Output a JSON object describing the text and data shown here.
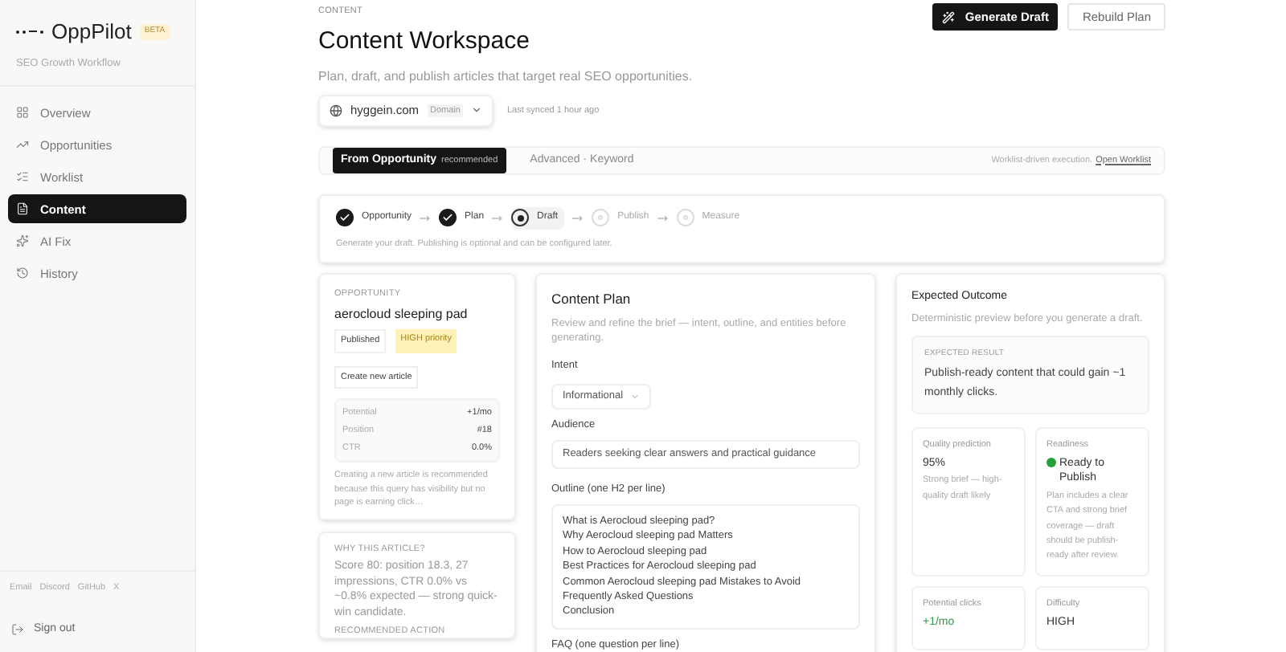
{
  "sidebar": {
    "brand": "OppPilot",
    "badge": "BETA",
    "subtitle": "SEO Growth Workflow",
    "items": [
      {
        "label": "Overview",
        "selected": false
      },
      {
        "label": "Opportunities",
        "selected": false
      },
      {
        "label": "Worklist",
        "selected": false
      },
      {
        "label": "Content",
        "selected": true
      },
      {
        "label": "AI Fix",
        "selected": false
      },
      {
        "label": "History",
        "selected": false
      }
    ],
    "footer_links": [
      "Email",
      "Discord",
      "GitHub",
      "X"
    ],
    "sign_out": "Sign out"
  },
  "header": {
    "eyebrow": "CONTENT",
    "title": "Content Workspace",
    "subtitle": "Plan, draft, and publish articles that target real SEO opportunities.",
    "primary_button": "Generate Draft",
    "secondary_button": "Rebuild Plan"
  },
  "domain": {
    "value": "hyggein.com",
    "tag": "Domain",
    "synced": "Last synced 1 hour ago"
  },
  "modes": [
    {
      "label": "From Opportunity",
      "note": "recommended",
      "selected": true
    },
    {
      "label": "Advanced · Keyword",
      "selected": false
    }
  ],
  "mode_hint": "Worklist-driven execution.",
  "mode_link": "Open Worklist",
  "steps": [
    {
      "label": "Opportunity",
      "completed": true,
      "selected": false
    },
    {
      "label": "Plan",
      "completed": true,
      "selected": false
    },
    {
      "label": "Draft",
      "completed": false,
      "selected": true
    },
    {
      "label": "Publish",
      "completed": false,
      "selected": false
    },
    {
      "label": "Measure",
      "completed": false,
      "selected": false
    }
  ],
  "steps_hint": "Generate your draft. Publishing is optional and can be configured later.",
  "opportunity": {
    "eyebrow": "OPPORTUNITY",
    "title": "aerocloud sleeping pad",
    "tags": [
      "Published",
      "HIGH priority"
    ],
    "action": "Create new article",
    "stats": [
      {
        "label": "Potential",
        "value": "+1/mo"
      },
      {
        "label": "Position",
        "value": "#18"
      },
      {
        "label": "CTR",
        "value": "0.0%"
      }
    ],
    "note": "Creating a new article is recommended because this query has visibility but no page is earning click…"
  },
  "why": {
    "eyebrow": "WHY THIS ARTICLE?",
    "text": "Score 80: position 18.3, 27 impressions, CTR 0.0% vs ~0.8% expected — strong quick-win candidate.",
    "next_eyebrow": "RECOMMENDED ACTION"
  },
  "plan": {
    "title": "Content Plan",
    "subtitle": "Review and refine the brief — intent, outline, and entities before generating.",
    "intent_label": "Intent",
    "intent_value": "Informational",
    "audience_label": "Audience",
    "audience_value": "Readers seeking clear answers and practical guidance",
    "outline_label": "Outline (one H2 per line)",
    "outline": [
      "What is Aerocloud sleeping pad?",
      "Why Aerocloud sleeping pad Matters",
      "How to Aerocloud sleeping pad",
      "Best Practices for Aerocloud sleeping pad",
      "Common Aerocloud sleeping pad Mistakes to Avoid",
      "Frequently Asked Questions",
      "Conclusion"
    ],
    "faq_label": "FAQ (one question per line)"
  },
  "outcome": {
    "title": "Expected Outcome",
    "subtitle": "Deterministic preview before you generate a draft.",
    "result_eyebrow": "EXPECTED RESULT",
    "result": "Publish-ready content that could gain ~1 monthly clicks.",
    "metrics": [
      {
        "label": "Quality prediction",
        "value": "95%",
        "note": "Strong brief — high-quality draft likely",
        "kind": "plain"
      },
      {
        "label": "Readiness",
        "value": "Ready to Publish",
        "note": "Plan includes a clear CTA and strong brief coverage — draft should be publish-ready after review.",
        "kind": "status",
        "color": "#22a33a"
      },
      {
        "label": "Potential clicks",
        "value": "+1/mo",
        "kind": "positive"
      },
      {
        "label": "Difficulty",
        "value": "HIGH",
        "kind": "plain"
      }
    ]
  }
}
